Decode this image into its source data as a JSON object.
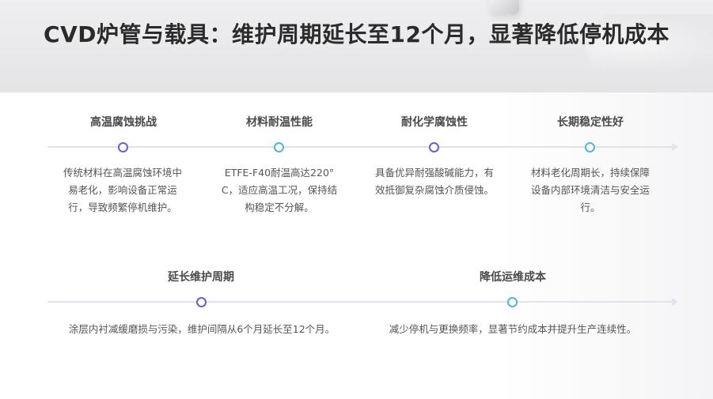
{
  "title": "CVD炉管与载具：维护周期延长至12个月，显著降低停机成本",
  "colors": {
    "purple": "#6a5fd2",
    "blue": "#56b3d8",
    "line": "#e2e2ea"
  },
  "row1": [
    {
      "label": "高温腐蚀挑战",
      "desc": "传统材料在高温腐蚀环境中易老化，影响设备正常运行，导致频繁停机维护。",
      "dot": "purple"
    },
    {
      "label": "材料耐温性能",
      "desc": "ETFE-F40耐温高达220°C，适应高温工况，保持结构稳定不分解。",
      "dot": "blue"
    },
    {
      "label": "耐化学腐蚀性",
      "desc": "具备优异耐强酸碱能力，有效抵御复杂腐蚀介质侵蚀。",
      "dot": "purple"
    },
    {
      "label": "长期稳定性好",
      "desc": "材料老化周期长，持续保障设备内部环境清洁与安全运行。",
      "dot": "blue"
    }
  ],
  "row2": [
    {
      "label": "延长维护周期",
      "desc": "涂层内衬减缓磨损与污染，维护间隔从6个月延长至12个月。",
      "dot": "purple"
    },
    {
      "label": "降低运维成本",
      "desc": "减少停机与更换频率，显著节约成本并提升生产连续性。",
      "dot": "blue"
    }
  ]
}
